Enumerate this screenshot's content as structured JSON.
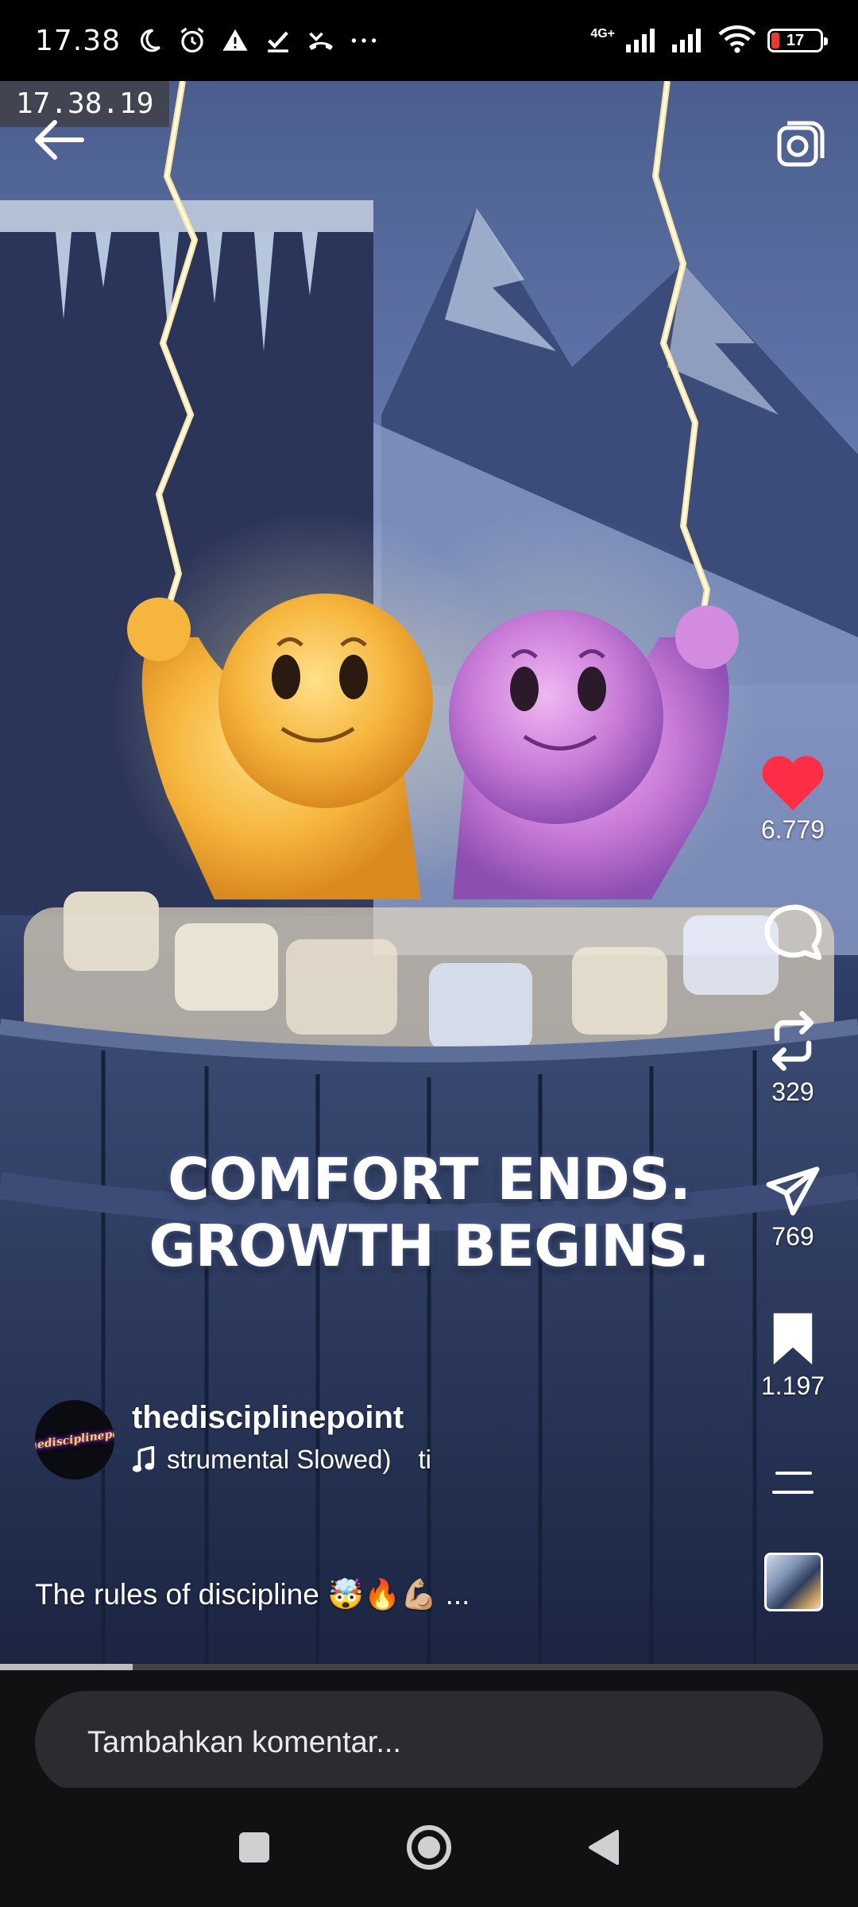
{
  "status_bar": {
    "time": "17.38",
    "network_label": "4G+",
    "battery_level": "17",
    "battery_fraction": 0.17,
    "icons": [
      "moon-icon",
      "alarm-icon",
      "warning-icon",
      "check-icon",
      "missed-call-icon",
      "more-dots-icon",
      "signal-icon",
      "signal-icon",
      "wifi-icon",
      "battery-icon"
    ]
  },
  "video": {
    "timestamp_overlay": "17.38.19",
    "caption_line1": "COMFORT ENDS.",
    "caption_line2": "GROWTH BEGINS."
  },
  "actions": {
    "like_count": "6.779",
    "repost_count": "329",
    "share_count": "769",
    "save_count": "1.197",
    "like_color": "#ff2d46"
  },
  "post": {
    "username": "thedisciplinepoint",
    "avatar_text": "@thedisciplinepoint",
    "music_text": "strumental Slowed)",
    "music_text_2": "ti",
    "description": "The rules of discipline 🤯🔥💪🏼 ..."
  },
  "playback": {
    "progress_fraction": 0.155
  },
  "comment": {
    "placeholder": "Tambahkan komentar..."
  }
}
